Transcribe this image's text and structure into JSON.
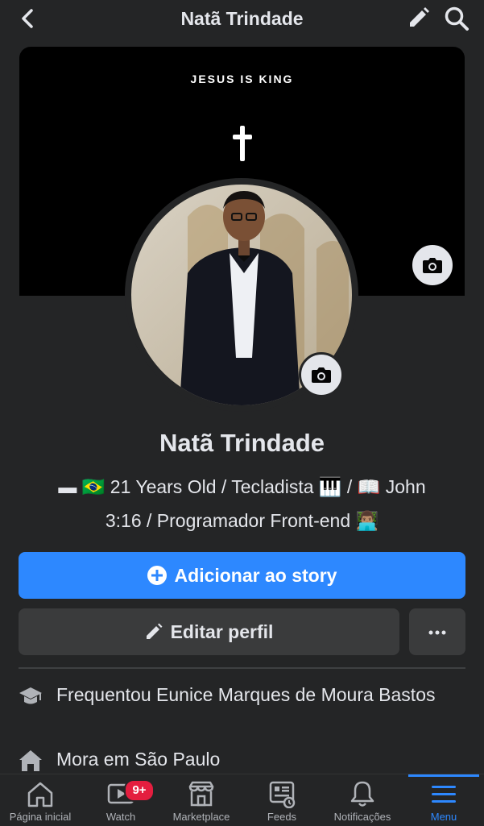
{
  "header": {
    "title": "Natã Trindade"
  },
  "cover": {
    "slogan": "JESUS IS KING"
  },
  "profile": {
    "name": "Natã Trindade",
    "bio_line1": "▬ 🇧🇷 21 Years Old / Tecladista 🎹 / 📖 John",
    "bio_line2": "3:16 /  Programador Front-end 👨🏽‍💻"
  },
  "buttons": {
    "story_label": "Adicionar ao story",
    "edit_label": "Editar perfil",
    "more_label": "···"
  },
  "details": {
    "school_prefix": "Frequentou",
    "school_name": "Eunice Marques de Moura Bastos",
    "city_prefix": "Mora em",
    "city_name": "São Paulo"
  },
  "nav": {
    "items": [
      {
        "label": "Página inicial",
        "icon": "home-icon"
      },
      {
        "label": "Watch",
        "icon": "watch-icon",
        "badge": "9+"
      },
      {
        "label": "Marketplace",
        "icon": "marketplace-icon"
      },
      {
        "label": "Feeds",
        "icon": "feeds-icon"
      },
      {
        "label": "Notificações",
        "icon": "bell-icon"
      },
      {
        "label": "Menu",
        "icon": "menu-icon",
        "active": true
      }
    ]
  },
  "colors": {
    "accent": "#2d88ff",
    "background": "#242526",
    "button": "#3a3b3c",
    "badge": "#e41e3f"
  }
}
